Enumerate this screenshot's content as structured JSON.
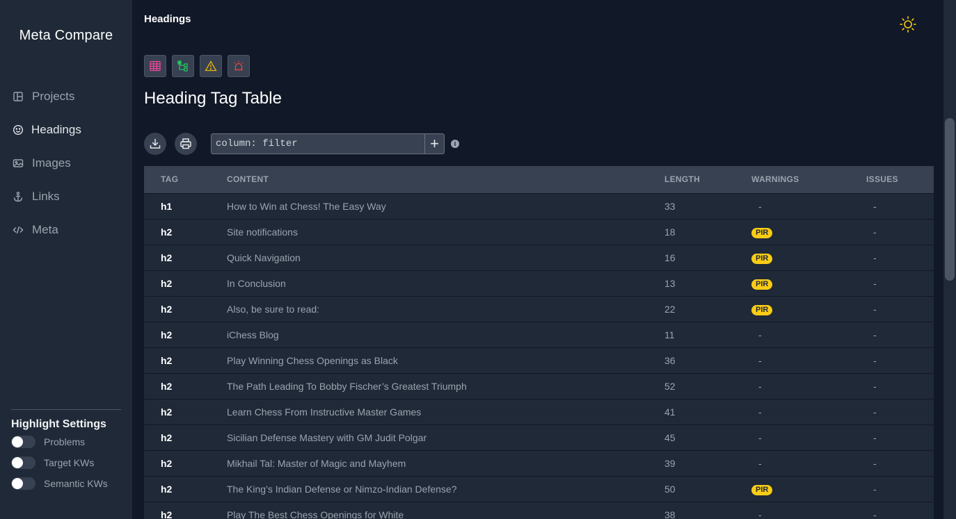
{
  "app": {
    "title": "Meta Compare"
  },
  "sidebar": {
    "items": [
      {
        "label": "Projects",
        "icon": "layout-icon",
        "active": false
      },
      {
        "label": "Headings",
        "icon": "smiley-icon",
        "active": true
      },
      {
        "label": "Images",
        "icon": "image-icon",
        "active": false
      },
      {
        "label": "Links",
        "icon": "anchor-icon",
        "active": false
      },
      {
        "label": "Meta",
        "icon": "code-icon",
        "active": false
      }
    ],
    "highlight": {
      "title": "Highlight Settings",
      "toggles": [
        {
          "label": "Problems",
          "on": false
        },
        {
          "label": "Target KWs",
          "on": false
        },
        {
          "label": "Semantic KWs",
          "on": false
        }
      ]
    }
  },
  "header": {
    "crumb": "Headings",
    "theme_icon": "sun-icon"
  },
  "views": [
    {
      "icon": "table-icon",
      "color": "#ec4899"
    },
    {
      "icon": "tree-icon",
      "color": "#22c55e"
    },
    {
      "icon": "warning-icon",
      "color": "#eab308"
    },
    {
      "icon": "alarm-icon",
      "color": "#ef4444"
    }
  ],
  "section": {
    "title": "Heading Tag Table"
  },
  "toolbar": {
    "filter_placeholder": "column: filter",
    "add_label": "+",
    "info_label": "i"
  },
  "colors": {
    "badge": "#facc15",
    "background": "#111827",
    "sidebar": "#1f2937"
  },
  "table": {
    "columns": [
      "TAG",
      "CONTENT",
      "LENGTH",
      "WARNINGS",
      "ISSUES"
    ],
    "rows": [
      {
        "tag": "h1",
        "content": "How to Win at Chess! The Easy Way",
        "length": "33",
        "warnings": "-",
        "issues": "-"
      },
      {
        "tag": "h2",
        "content": "Site notifications",
        "length": "18",
        "warnings": "PIR",
        "issues": "-"
      },
      {
        "tag": "h2",
        "content": "Quick Navigation",
        "length": "16",
        "warnings": "PIR",
        "issues": "-"
      },
      {
        "tag": "h2",
        "content": "In Conclusion",
        "length": "13",
        "warnings": "PIR",
        "issues": "-"
      },
      {
        "tag": "h2",
        "content": "Also, be sure to read:",
        "length": "22",
        "warnings": "PIR",
        "issues": "-"
      },
      {
        "tag": "h2",
        "content": "iChess Blog",
        "length": "11",
        "warnings": "-",
        "issues": "-"
      },
      {
        "tag": "h2",
        "content": "Play Winning Chess Openings as Black",
        "length": "36",
        "warnings": "-",
        "issues": "-"
      },
      {
        "tag": "h2",
        "content": "The Path Leading To Bobby Fischer’s Greatest Triumph",
        "length": "52",
        "warnings": "-",
        "issues": "-"
      },
      {
        "tag": "h2",
        "content": "Learn Chess From Instructive Master Games",
        "length": "41",
        "warnings": "-",
        "issues": "-"
      },
      {
        "tag": "h2",
        "content": "Sicilian Defense Mastery with GM Judit Polgar",
        "length": "45",
        "warnings": "-",
        "issues": "-"
      },
      {
        "tag": "h2",
        "content": "Mikhail Tal: Master of Magic and Mayhem",
        "length": "39",
        "warnings": "-",
        "issues": "-"
      },
      {
        "tag": "h2",
        "content": "The King’s Indian Defense or Nimzo-Indian Defense?",
        "length": "50",
        "warnings": "PIR",
        "issues": "-"
      },
      {
        "tag": "h2",
        "content": "Play The Best Chess Openings for White",
        "length": "38",
        "warnings": "-",
        "issues": "-"
      }
    ]
  }
}
